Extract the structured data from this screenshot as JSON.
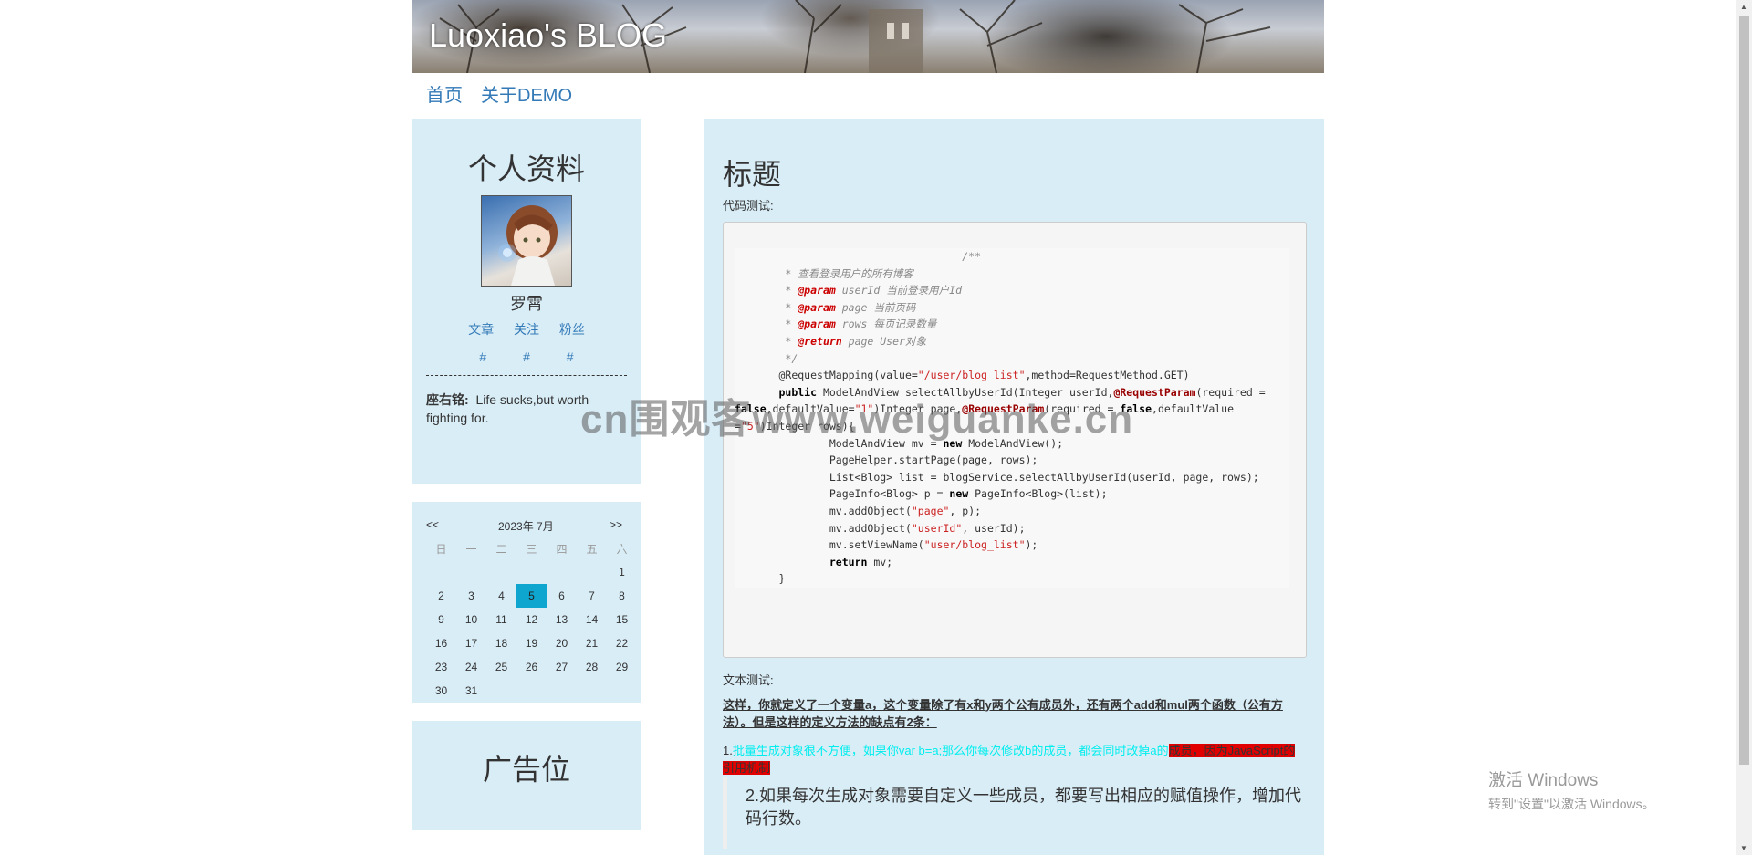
{
  "blog": {
    "title": "Luoxiao's BLOG"
  },
  "nav": {
    "items": [
      {
        "label": "首页"
      },
      {
        "label": "关于DEMO"
      }
    ]
  },
  "profile": {
    "heading": "个人资料",
    "name": "罗霄",
    "links": [
      "文章",
      "关注",
      "粉丝"
    ],
    "counts": [
      "#",
      "#",
      "#"
    ],
    "motto_label": "座右铭:",
    "motto": "Life sucks,but worth fighting for."
  },
  "calendar": {
    "prev": "<<",
    "next": ">>",
    "month": "2023年 7月",
    "weekdays": [
      "日",
      "一",
      "二",
      "三",
      "四",
      "五",
      "六"
    ],
    "weeks": [
      [
        "",
        "",
        "",
        "",
        "",
        "",
        "1"
      ],
      [
        "2",
        "3",
        "4",
        "5",
        "6",
        "7",
        "8"
      ],
      [
        "9",
        "10",
        "11",
        "12",
        "13",
        "14",
        "15"
      ],
      [
        "16",
        "17",
        "18",
        "19",
        "20",
        "21",
        "22"
      ],
      [
        "23",
        "24",
        "25",
        "26",
        "27",
        "28",
        "29"
      ],
      [
        "30",
        "31",
        "",
        "",
        "",
        "",
        ""
      ]
    ],
    "today": "5"
  },
  "ad": {
    "heading": "广告位"
  },
  "post": {
    "title": "标题",
    "code_label": "代码测试:",
    "text_label": "文本测试:",
    "para1": "这样，你就定义了一个变量a，这个变量除了有x和y两个公有成员外，还有两个add和mul两个函数（公有方法）。但是这样的定义方法的缺点有2条：",
    "para2_prefix": "1.",
    "para2_main": "批量生成对象很不方便，如果你var b=a;那么你每次修改b的成员，都会同时改掉a的",
    "para2_highlight": "成员，因为JavaScript的引用机制",
    "quote": "2.如果每次生成对象需要自定义一些成员，都要写出相应的赋值操作，增加代码行数。"
  },
  "watermark": "cn围观客www.weiguanke.cn",
  "windows_activation": {
    "line1": "激活 Windows",
    "line2": "转到\"设置\"以激活 Windows。"
  },
  "colors": {
    "panel": "#d9edf7",
    "link": "#337ab7",
    "today": "#0ea5cf",
    "highlight": "#e00000",
    "cyan_text": "#00eeee"
  }
}
